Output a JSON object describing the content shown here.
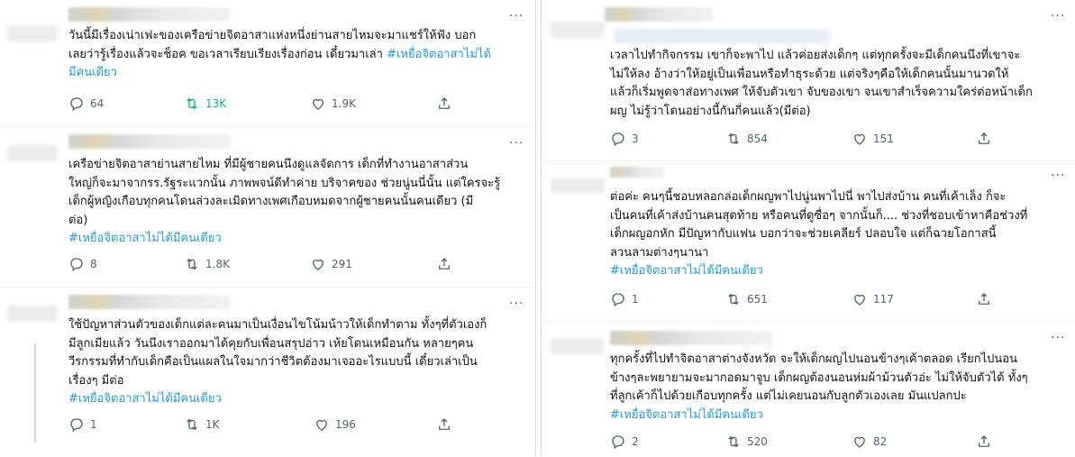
{
  "left_tweets": [
    {
      "lines": [
        "วันนี้มีเรื่องเน่าเฟะของเครือข่ายจิตอาสาแห่งหนึ่งย่านสายไหมจะมาแชร์ให้ฟัง บอก",
        "เลยว่ารู้เรื่องแล้วจะช็อค ขอเวลาเรียบเรียงเรื่องก่อน เดี๋ยวมาเล่า"
      ],
      "hashtag_inline": "#เหยื่อจิตอาสาไม่ได้",
      "hashtag_line": "มีคนเดียว",
      "replies": "64",
      "retweets": "13K",
      "likes": "1.9K"
    },
    {
      "lines": [
        "เครือข่ายจิตอาสาย่านสายไหม ที่มีผู้ชายคนนึงดูแลจัดการ เด็กที่ทำงานอาสาส่วน",
        "ใหญ่ก็จะมาจากรร.รัฐระแวกนั้น ภาพพจน์ดีทำค่าย บริจาคของ ช่วยนู่นนี่นั้น แต่ใครจะรู้",
        "เด็กผู้หญิงเกือบทุกคนโดนล่วงละเมิดทางเพศเกือบหมดจากผู้ชายคนนั้นคนเดียว (มี",
        "ต่อ)"
      ],
      "hashtag": "#เหยื่อจิตอาสาไม่ได้มีคนเดียว",
      "replies": "8",
      "retweets": "1.8K",
      "likes": "291"
    },
    {
      "lines": [
        "ใช้ปัญหาส่วนตัวของเด็กแต่ละคนมาเป็นเงื่อนไขโน้มน้าวให้เด็กทำตาม ทั้งๆที่ตัวเองก็",
        "มีลูกเมียแล้ว วันนึงเราออกมาได้คุยกับเพื่อนสรุปอ่าว เห้ยโดนเหมือนกัน หลายๆคน",
        "วีรกรรมที่ทำกับเด็กคือเป็นแผลในใจมากว่าชีวิตต้องมาเจออะไรแบบนี้ เดี๋ยวเล่าเป็น",
        "เรื่องๆ มีต่อ"
      ],
      "hashtag": "#เหยื่อจิตอาสาไม่ได้มีคนเดียว",
      "replies": "1",
      "retweets": "1K",
      "likes": "196"
    }
  ],
  "right_tweets": [
    {
      "lines": [
        "เวลาไปทำกิจกรรม เขาก็จะพาไป แล้วค่อยส่งเด็กๆ แต่ทุกครั้งจะมีเด็กคนนึงที่เขาจะ",
        "ไม่ให้ลง อ้างว่าให้อยู่เป็นเพื่อนหรือทำธุระด้วย แต่จริงๆคือให้เด็กคนนั้นมานวดให้",
        "แล้วก็เริ่มพูดจาส่อทางเพศ ให้จับตัวเขา จับของเขา จนเขาสำเร็จความใคร่ต่อหน้าเด็ก",
        "ผญ ไม่รู้ว่าโดนอย่างนี้กันกี่คนแล้ว(มีต่อ)"
      ],
      "hashtag": "",
      "replies": "3",
      "retweets": "854",
      "likes": "151"
    },
    {
      "lines": [
        "ต่อค่ะ คนๆนี้ชอบหลอกล่อเด็กผญพาไปนู่นพาไปนี่ พาไปส่งบ้าน คนที่เค้าเล็ง ก็จะ",
        "เป็นคนที่เค้าส่งบ้านคนสุดท้าย หรือคนที่ดูซื่อๆ จากนั้นก็.... ช่วงที่ชอบเข้าหาคือช่วงที่",
        "เด็กผญอกหัก มีปัญหากับแฟน บอกว่าจะช่วยเคลียร์ ปลอบใจ แต่ก็ฉวยโอกาสนี้",
        "ลวนลามต่างๆนานา"
      ],
      "hashtag": "#เหยื่อจิตอาสาไม่ได้มีคนเดียว",
      "replies": "1",
      "retweets": "651",
      "likes": "117"
    },
    {
      "lines": [
        "ทุกครั้งที่ไปทำจิตอาสาต่างจังหวัด จะให้เด็กผญไปนอนข้างๆเค้าตลอด เรียกไปนอน",
        "ข้างๆละพยายามจะมากอดมาจูบ เด็กผญต้องนอนห่มผ้าม้วนตัวอ่ะ ไม่ให้จับตัวได้ ทั้งๆ",
        "ที่ลูกเค้าก็ไปด้วยเกือบทุกครั้ง แต่ไม่เคยนอนกับลูกตัวเองเลย มันแปลกปะ"
      ],
      "hashtag": "#เหยื่อจิตอาสาไม่ได้มีคนเดียว",
      "replies": "2",
      "retweets": "520",
      "likes": "82"
    }
  ],
  "more_glyph": "···",
  "colors": {
    "hashtag": "#1d9bf0",
    "retweet_active": "#00ba7c",
    "meta": "#536471"
  }
}
